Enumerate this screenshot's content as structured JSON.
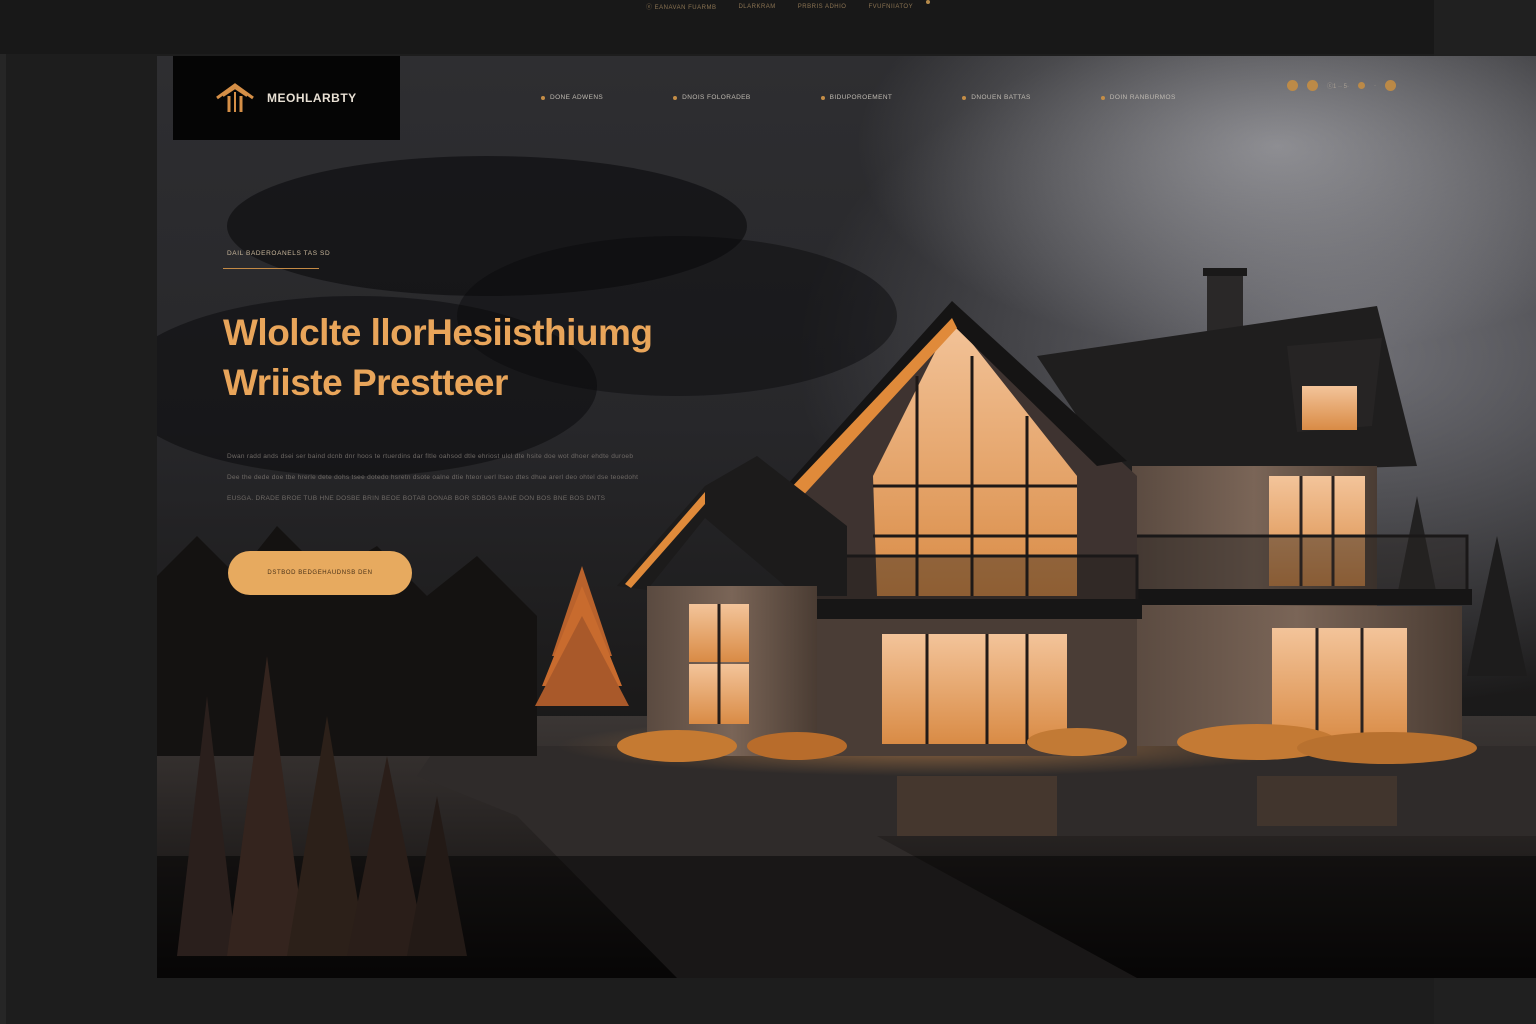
{
  "top_strip": {
    "nav": [
      "ⓔ EANAVAN FUARMB",
      "DLARKRAM",
      "PRBRIS ADHIO",
      "FVUFNIIATOY"
    ]
  },
  "brand": {
    "name": "MEOHLARBTY"
  },
  "nav": {
    "items": [
      "DONE ADWENS",
      "DNOIS FOLORADEB",
      "BIDUPOROEMENT",
      "DNOUEN BATTAS",
      "DOIN RANBURMOS"
    ],
    "icon_text": [
      "ⓒ1 ·· 5·",
      "·"
    ]
  },
  "hero": {
    "eyebrow": "DAIL BADEROANELS TAS SD",
    "headline": [
      "Wlolclte llorHesiisthiumg",
      "Wriiste Prestteer"
    ],
    "body_lines": [
      "Dwan radd ands dsei ser baind dcnb dnr hoos te rtuerdins dar fltle oahsod dtle ehriost ulcl dte hsite doe wot dhoer ehdte duroeb",
      "Dee the dede doe tbe hrerle dete dohs tsee dotedo hsretn dsote oalne dtie hteor uerl ltseo dtes dhue arerl deo ohtel dse teoedoht",
      "EUSGA. DRADE BROE TUB HNE DOSBE BRIN BEOE BOTAB DONAB BOR SDBOS BANE DON BOS BNE BOS DNTS"
    ],
    "cta_label": "DSTBOD BEDGEHAUDNSB DEN"
  },
  "colors": {
    "accent": "#e7aa5f",
    "headline": "#e9a55a",
    "dark": "#1b1a1a"
  }
}
